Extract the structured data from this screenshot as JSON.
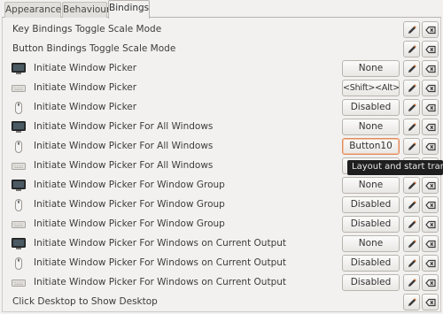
{
  "tabs": [
    {
      "label": "Appearance",
      "active": false
    },
    {
      "label": "Behaviour",
      "active": false
    },
    {
      "label": "Bindings",
      "active": true
    }
  ],
  "rows": [
    {
      "label": "Key Bindings Toggle Scale Mode",
      "device": "none",
      "control": "checkbox",
      "checked": true
    },
    {
      "label": "Button Bindings Toggle Scale Mode",
      "device": "none",
      "control": "checkbox",
      "checked": true
    },
    {
      "label": "Initiate Window Picker",
      "device": "screen-edge-icon",
      "control": "binding",
      "value": "None"
    },
    {
      "label": "Initiate Window Picker",
      "device": "keyboard-icon",
      "control": "binding",
      "value": "<Shift><Alt>Up"
    },
    {
      "label": "Initiate Window Picker",
      "device": "mouse-icon",
      "control": "binding",
      "value": "Disabled"
    },
    {
      "label": "Initiate Window Picker For All Windows",
      "device": "screen-edge-icon",
      "control": "binding",
      "value": "None"
    },
    {
      "label": "Initiate Window Picker For All Windows",
      "device": "mouse-icon",
      "control": "binding",
      "value": "Button10",
      "focused": true
    },
    {
      "label": "Initiate Window Picker For All Windows",
      "device": "keyboard-icon",
      "control": "binding",
      "value": ""
    },
    {
      "label": "Initiate Window Picker For Window Group",
      "device": "screen-edge-icon",
      "control": "binding",
      "value": "None"
    },
    {
      "label": "Initiate Window Picker For Window Group",
      "device": "mouse-icon",
      "control": "binding",
      "value": "Disabled"
    },
    {
      "label": "Initiate Window Picker For Window Group",
      "device": "keyboard-icon",
      "control": "binding",
      "value": "Disabled"
    },
    {
      "label": "Initiate Window Picker For Windows on Current Output",
      "device": "screen-edge-icon",
      "control": "binding",
      "value": "None"
    },
    {
      "label": "Initiate Window Picker For Windows on Current Output",
      "device": "mouse-icon",
      "control": "binding",
      "value": "Disabled"
    },
    {
      "label": "Initiate Window Picker For Windows on Current Output",
      "device": "keyboard-icon",
      "control": "binding",
      "value": "Disabled"
    },
    {
      "label": "Click Desktop to Show Desktop",
      "device": "none",
      "control": "checkbox",
      "checked": false
    }
  ],
  "tooltip": {
    "text": "Layout and start transfo"
  },
  "colors": {
    "accent": "#e56a2a",
    "tooltip_bg": "#1f1f1f",
    "background": "#f2f1f0"
  }
}
